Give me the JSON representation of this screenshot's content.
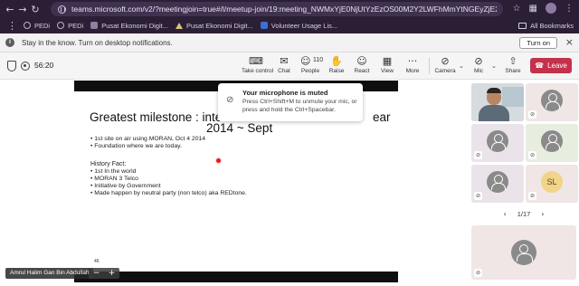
{
  "browser": {
    "url": "teams.microsoft.com/v2/?meetingjoin=true#/l/meetup-join/19:meeting_NWMxYjE0NjUtYzEzOS00M2Y2LWFhMmYtNGEyZjE2OWEyNmM1@thread.v...",
    "bookmarks": [
      "PEDi",
      "PEDi",
      "Pusat Ekonomi Digit...",
      "Pusat Ekonomi Digit...",
      "Volunteer Usage Lis..."
    ],
    "all_bookmarks": "All Bookmarks",
    "notification_text": "Stay in the know. Turn on desktop notifications.",
    "notification_button": "Turn on"
  },
  "meeting": {
    "timer": "56:20",
    "toolbar": {
      "take_control": "Take control",
      "chat": "Chat",
      "people": "People",
      "people_count": "110",
      "raise": "Raise",
      "react": "React",
      "view": "View",
      "more": "More",
      "camera": "Camera",
      "mic": "Mic",
      "share": "Share",
      "leave": "Leave"
    }
  },
  "slide": {
    "title_line1": "Greatest milestone : interconn",
    "title_line1_tail": "ear",
    "title_line2": "2014 ~ Sept",
    "bullets": [
      "1st site on air using MORAN, Oct 4 2014",
      "Foundation where we are today."
    ],
    "history_title": "History Fact:",
    "history": [
      "1st In the world",
      "MORAN 3 Telco",
      "Initiative by Government",
      "Made happen by neutral party (non telco) aka REDtone."
    ],
    "slide_number": "46"
  },
  "presenter_name": "Amrul Halim Gan Bin Abdullah",
  "zoom_controls": [
    "−",
    "+"
  ],
  "toast": {
    "title": "Your microphone is muted",
    "body": "Press Ctrl+Shift+M to unmute your mic, or press and hold the Ctrl+Spacebar."
  },
  "gallery": {
    "initials": "SL",
    "page_indicator": "1/17"
  }
}
